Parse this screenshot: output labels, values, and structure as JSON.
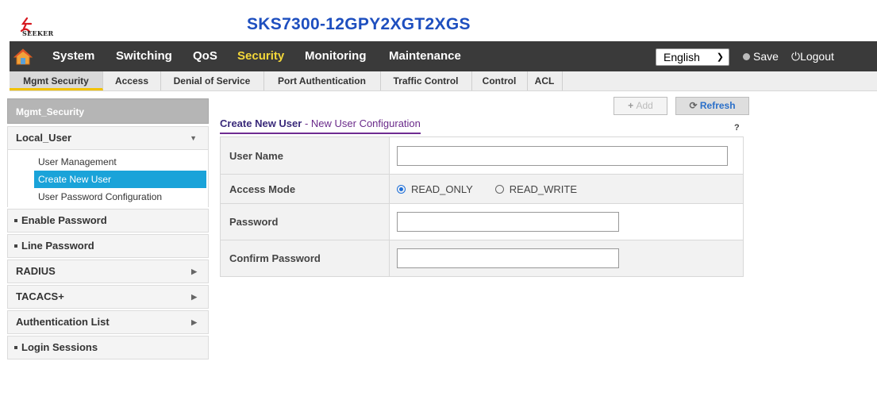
{
  "brand": {
    "logo_text": "SEEKER",
    "model": "SKS7300-12GPY2XGT2XGS"
  },
  "topnav": {
    "items": [
      "System",
      "Switching",
      "QoS",
      "Security",
      "Monitoring",
      "Maintenance"
    ],
    "active": "Security",
    "language": "English",
    "save_label": "Save",
    "logout_label": "Logout"
  },
  "subtabs": {
    "items": [
      "Mgmt Security",
      "Access",
      "Denial of Service",
      "Port Authentication",
      "Traffic Control",
      "Control",
      "ACL"
    ],
    "active": "Mgmt Security"
  },
  "sidebar": {
    "header": "Mgmt_Security",
    "local_user": {
      "label": "Local_User",
      "items": [
        "User Management",
        "Create New User",
        "User Password Configuration"
      ],
      "active": "Create New User"
    },
    "groups": [
      "Enable Password",
      "Line Password",
      "RADIUS",
      "TACACS+",
      "Authentication List",
      "Login Sessions"
    ]
  },
  "content": {
    "add_label": "Add",
    "refresh_label": "Refresh",
    "help": "?",
    "title_main": "Create New User",
    "title_sep": " - ",
    "title_sub": "New User Configuration",
    "fields": {
      "user_name": {
        "label": "User Name",
        "value": ""
      },
      "access_mode": {
        "label": "Access Mode",
        "options": [
          "READ_ONLY",
          "READ_WRITE"
        ],
        "selected": "READ_ONLY"
      },
      "password": {
        "label": "Password",
        "value": ""
      },
      "confirm_password": {
        "label": "Confirm Password",
        "value": ""
      }
    }
  },
  "colors": {
    "nav_bg": "#3a3a3a",
    "nav_active": "#f4d83a",
    "model_blue": "#1e4fbf",
    "sidebar_active": "#1aa3d9",
    "title_purple": "#6f2c91",
    "radio_blue": "#1e6fd9"
  }
}
